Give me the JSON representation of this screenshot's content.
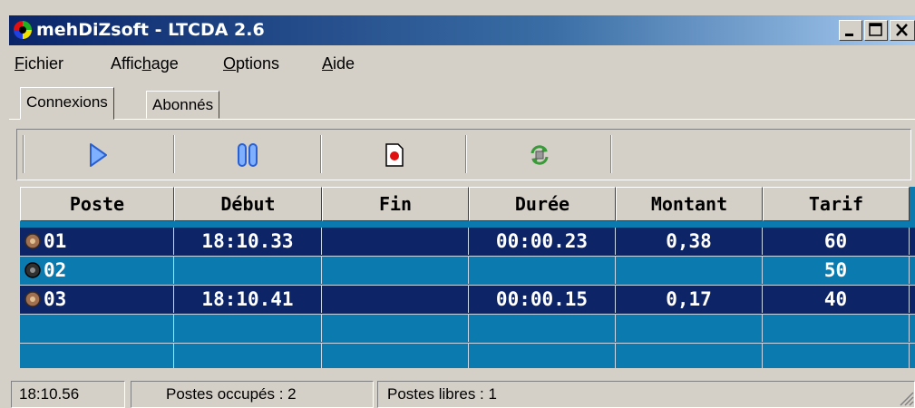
{
  "window": {
    "title": "mehDiZsoft - LTCDA 2.6",
    "controls": [
      "minimize",
      "maximize",
      "close"
    ]
  },
  "menu": [
    {
      "label": "Fichier",
      "accel": "F"
    },
    {
      "label": "Affichage",
      "accel": "h"
    },
    {
      "label": "Options",
      "accel": "O"
    },
    {
      "label": "Aide",
      "accel": "A"
    }
  ],
  "tabs": [
    {
      "label": "Connexions",
      "active": true
    },
    {
      "label": "Abonnés",
      "active": false
    }
  ],
  "toolbar": {
    "buttons": [
      {
        "name": "play",
        "icon": "play-icon"
      },
      {
        "name": "pause",
        "icon": "pause-icon"
      },
      {
        "name": "record",
        "icon": "record-icon"
      },
      {
        "name": "refresh",
        "icon": "refresh-icon"
      }
    ]
  },
  "table": {
    "columns": [
      "Poste",
      "Début",
      "Fin",
      "Durée",
      "Montant",
      "Tarif"
    ],
    "rows": [
      {
        "poste": "01",
        "debut": "18:10.33",
        "fin": "",
        "duree": "00:00.23",
        "montant": "0,38",
        "tarif": "60",
        "selected": true,
        "status": "active"
      },
      {
        "poste": "02",
        "debut": "",
        "fin": "",
        "duree": "",
        "montant": "",
        "tarif": "50",
        "selected": false,
        "status": "idle"
      },
      {
        "poste": "03",
        "debut": "18:10.41",
        "fin": "",
        "duree": "00:00.15",
        "montant": "0,17",
        "tarif": "40",
        "selected": true,
        "status": "active"
      }
    ]
  },
  "status": {
    "time": "18:10.56",
    "occupied": "Postes occupés : 2",
    "free": "Postes libres : 1"
  },
  "colors": {
    "selection": "#0d2466",
    "grid_bg": "#0a7aaf",
    "title_start": "#0a246a",
    "title_end": "#a6caf0"
  }
}
